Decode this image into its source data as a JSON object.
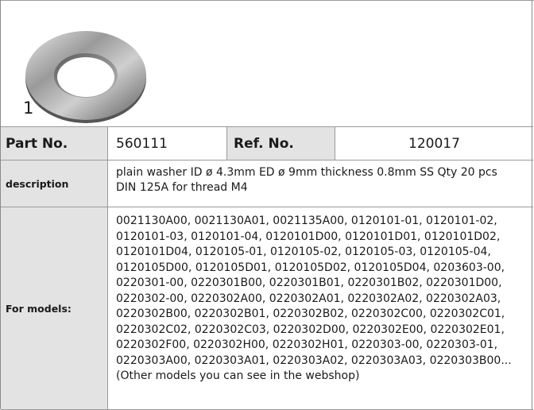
{
  "item_number": "1",
  "part": {
    "label": "Part No.",
    "value": "560111"
  },
  "ref": {
    "label": "Ref. No.",
    "value": "120017"
  },
  "description": {
    "label": "description",
    "line1": "plain washer  ID ø 4.3mm ED ø 9mm thickness 0.8mm SS Qty 20 pcs",
    "line2": "DIN 125A for thread M4"
  },
  "models": {
    "label": "For models:",
    "lines": [
      "0021130A00, 0021130A01, 0021135A00, 0120101-01, 0120101-02,",
      "0120101-03, 0120101-04, 0120101D00, 0120101D01, 0120101D02,",
      "0120101D04, 0120105-01, 0120105-02, 0120105-03, 0120105-04,",
      "0120105D00, 0120105D01, 0120105D02, 0120105D04, 0203603-00,",
      "0220301-00, 0220301B00, 0220301B01, 0220301B02, 0220301D00,",
      "0220302-00, 0220302A00, 0220302A01, 0220302A02, 0220302A03,",
      "0220302B00, 0220302B01, 0220302B02, 0220302C00, 0220302C01,",
      "0220302C02, 0220302C03, 0220302D00, 0220302E00, 0220302E01,",
      "0220302F00, 0220302H00, 0220302H01, 0220303-00, 0220303-01,",
      "0220303A00, 0220303A01, 0220303A02, 0220303A03, 0220303B00...",
      "(Other models you can see in the webshop)"
    ]
  },
  "colors": {
    "label_bg": "#e3e3e3",
    "border": "#9a9a9a"
  }
}
